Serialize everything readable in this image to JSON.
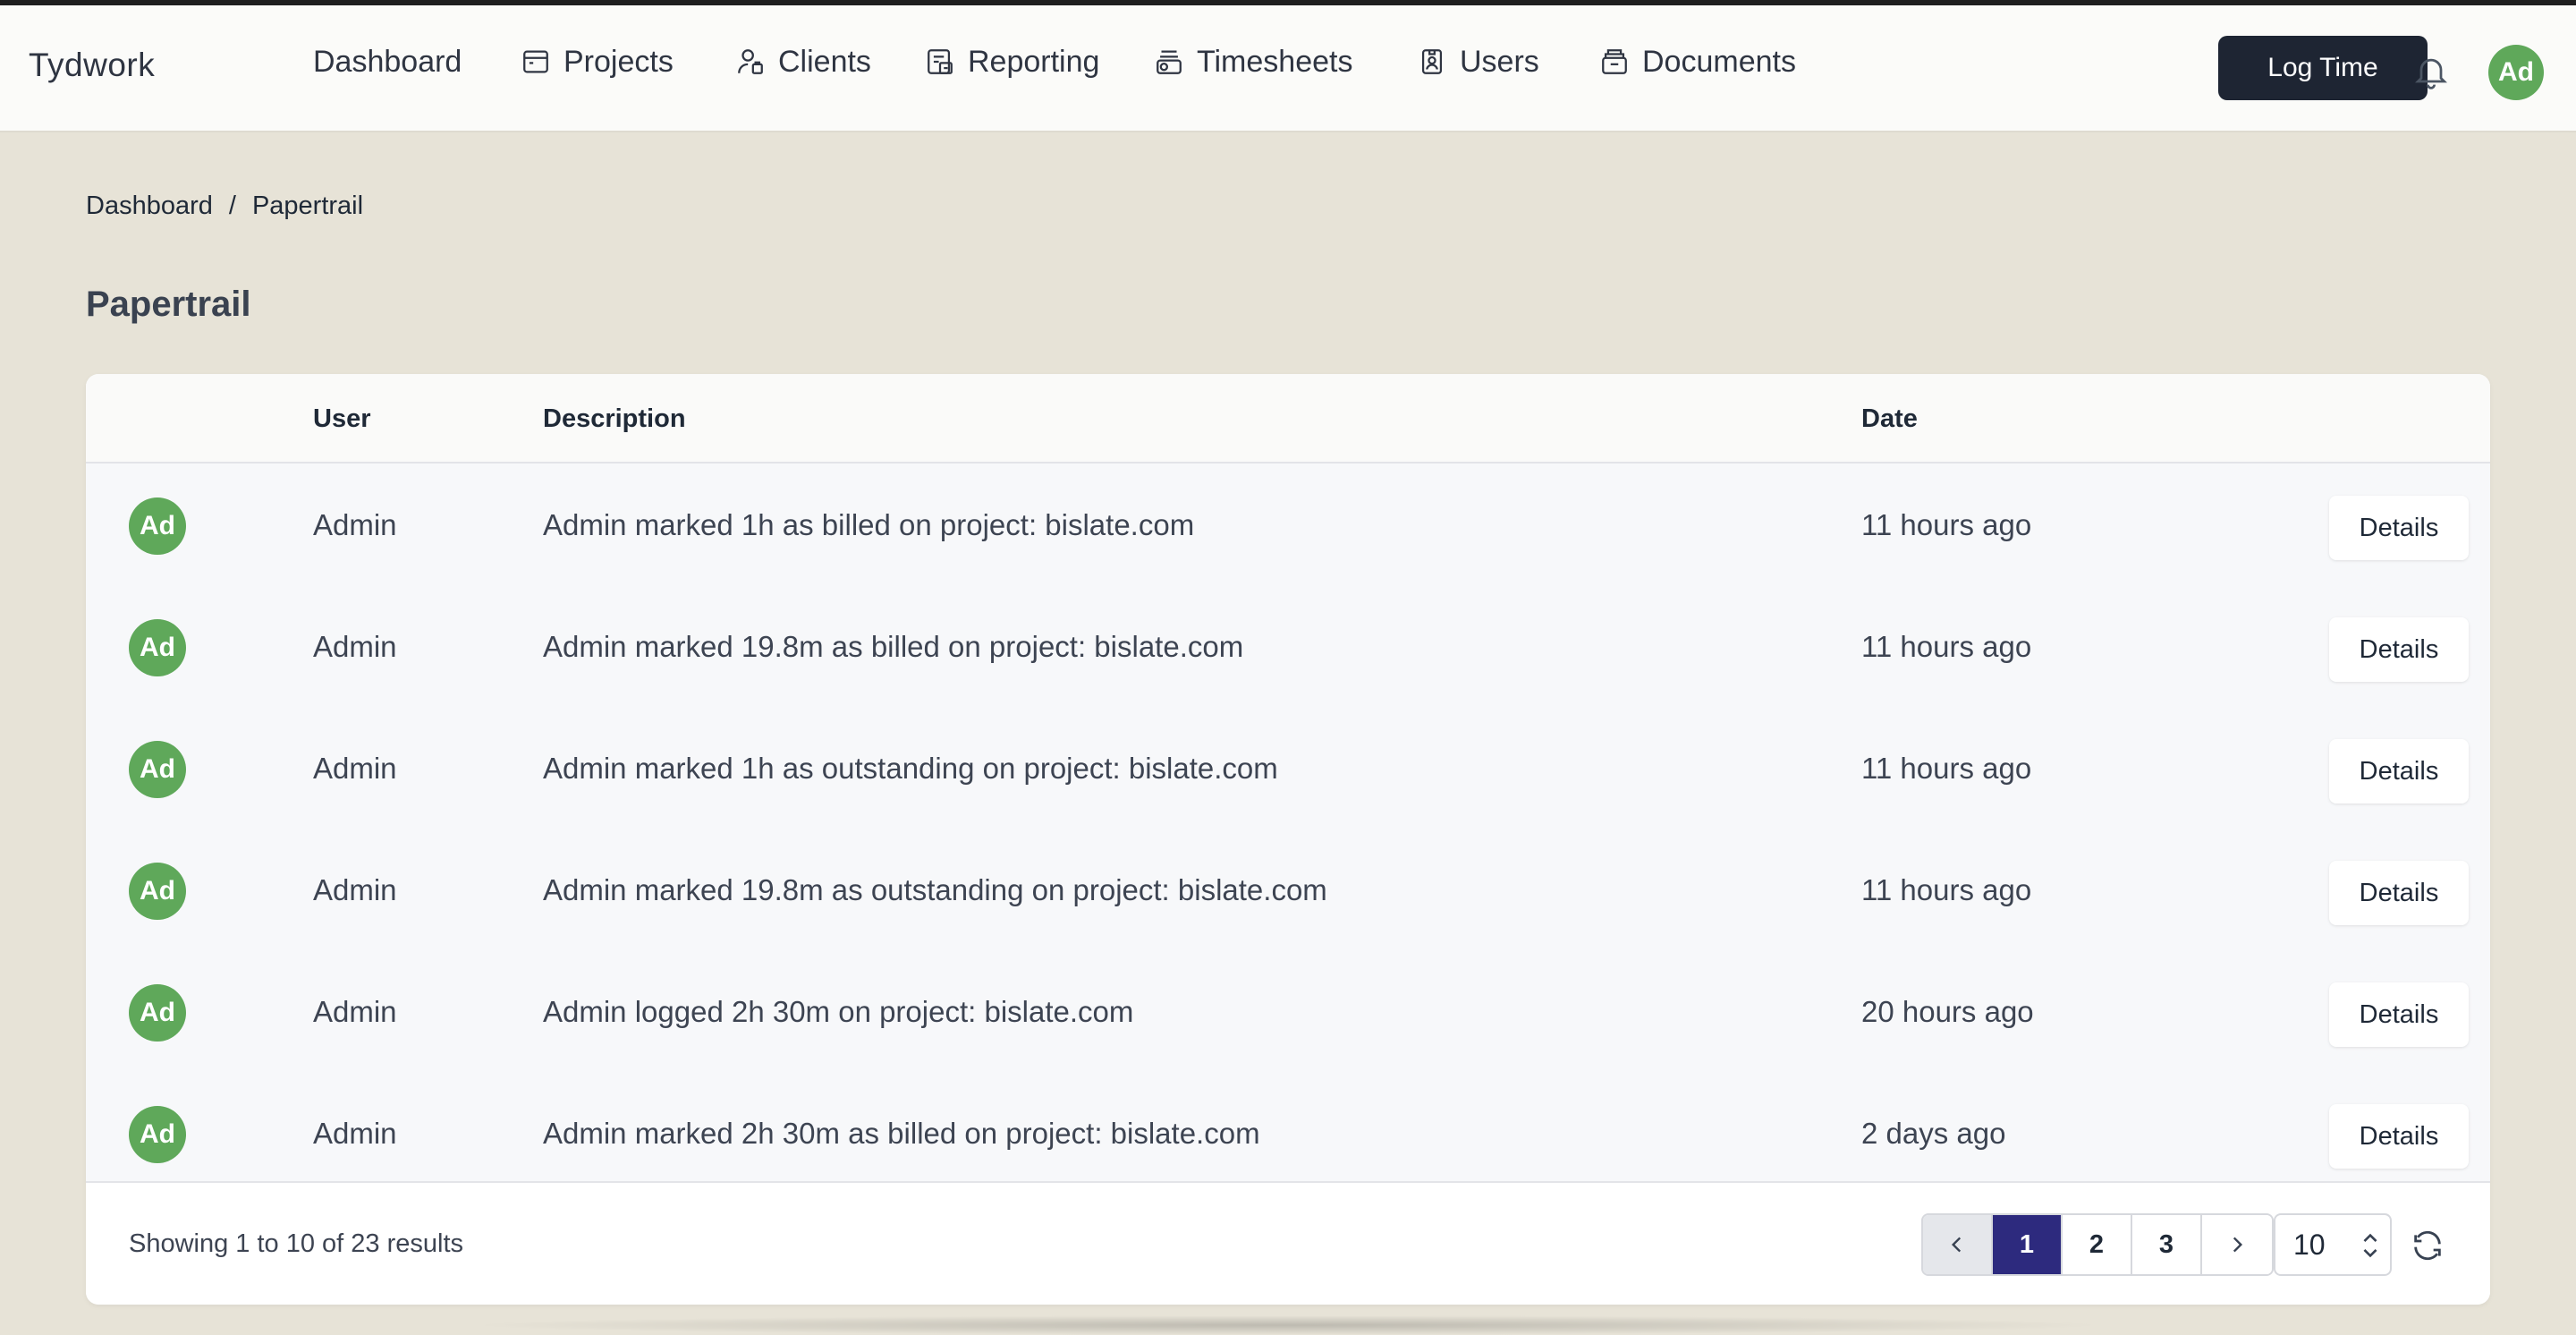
{
  "app": {
    "brand": "Tydwork"
  },
  "nav": {
    "items": [
      {
        "label": "Dashboard",
        "icon": ""
      },
      {
        "label": "Projects",
        "icon": "folder-icon"
      },
      {
        "label": "Clients",
        "icon": "client-icon"
      },
      {
        "label": "Reporting",
        "icon": "reporting-icon"
      },
      {
        "label": "Timesheets",
        "icon": "timesheets-icon"
      },
      {
        "label": "Users",
        "icon": "id-badge-icon"
      },
      {
        "label": "Documents",
        "icon": "documents-icon"
      }
    ],
    "log_time": "Log Time",
    "avatar": "Ad"
  },
  "breadcrumb": {
    "root": "Dashboard",
    "sep": "/",
    "current": "Papertrail"
  },
  "page": {
    "title": "Papertrail"
  },
  "table": {
    "headers": {
      "user": "User",
      "description": "Description",
      "date": "Date"
    },
    "details_label": "Details",
    "rows": [
      {
        "avatar": "Ad",
        "user": "Admin",
        "description": "Admin marked 1h as billed on project: bislate.com",
        "date": "11 hours ago"
      },
      {
        "avatar": "Ad",
        "user": "Admin",
        "description": "Admin marked 19.8m as billed on project: bislate.com",
        "date": "11 hours ago"
      },
      {
        "avatar": "Ad",
        "user": "Admin",
        "description": "Admin marked 1h as outstanding on project: bislate.com",
        "date": "11 hours ago"
      },
      {
        "avatar": "Ad",
        "user": "Admin",
        "description": "Admin marked 19.8m as outstanding on project: bislate.com",
        "date": "11 hours ago"
      },
      {
        "avatar": "Ad",
        "user": "Admin",
        "description": "Admin logged 2h 30m on project: bislate.com",
        "date": "20 hours ago"
      },
      {
        "avatar": "Ad",
        "user": "Admin",
        "description": "Admin marked 2h 30m as billed on project: bislate.com",
        "date": "2 days ago"
      }
    ]
  },
  "footer": {
    "results": "Showing 1 to 10 of 23 results",
    "pages": [
      "1",
      "2",
      "3"
    ],
    "current_page": "1",
    "per_page": "10"
  },
  "colors": {
    "accent": "#2d2a7e",
    "avatar": "#5fa85a",
    "primary_button": "#1e2533",
    "background": "#e7e3d7"
  }
}
